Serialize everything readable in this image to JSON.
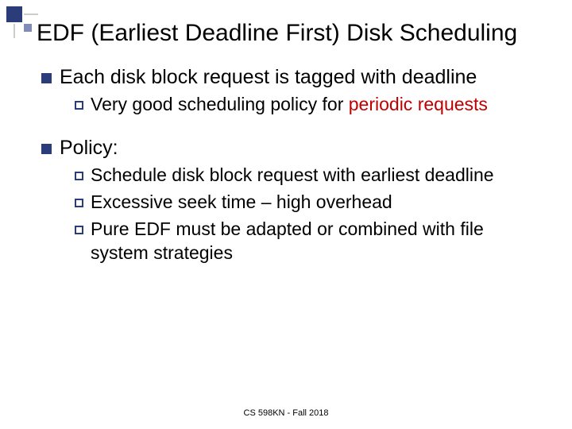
{
  "title": "EDF (Earliest Deadline First) Disk Scheduling",
  "bullets": [
    {
      "text": "Each disk block request is tagged with deadline",
      "children": [
        {
          "prefix": "Very good scheduling policy for ",
          "red": "periodic requests"
        }
      ]
    },
    {
      "text": "Policy:",
      "children": [
        {
          "prefix": "Schedule disk block request with earliest deadline"
        },
        {
          "prefix": "Excessive seek time – high overhead"
        },
        {
          "prefix": "Pure EDF must be adapted or combined with file system strategies"
        }
      ]
    }
  ],
  "footer": "CS 598KN - Fall 2018"
}
